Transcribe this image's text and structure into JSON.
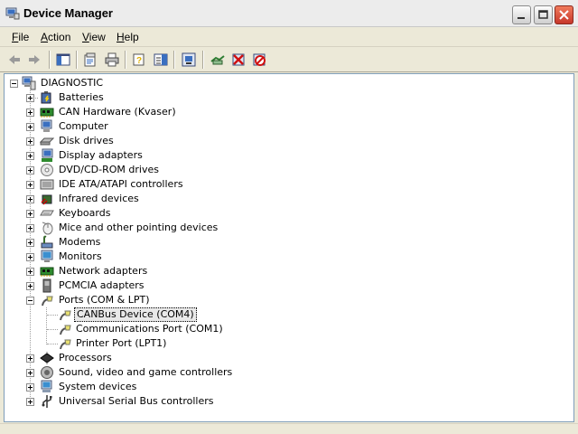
{
  "window": {
    "title": "Device Manager"
  },
  "menu": [
    {
      "label": "File",
      "accel": "F",
      "rest": "ile"
    },
    {
      "label": "Action",
      "accel": "A",
      "rest": "ction"
    },
    {
      "label": "View",
      "accel": "V",
      "rest": "iew"
    },
    {
      "label": "Help",
      "accel": "H",
      "rest": "elp"
    }
  ],
  "toolbar": {
    "buttons": [
      "back-icon",
      "forward-icon",
      "show-hide-tree-icon",
      "properties-icon",
      "print-icon",
      "help-icon",
      "export-list-icon",
      "update-driver-icon",
      "scan-hardware-icon",
      "uninstall-icon",
      "disable-icon"
    ]
  },
  "tree": {
    "root": "DIAGNOSTIC",
    "categories": [
      "Batteries",
      "CAN Hardware (Kvaser)",
      "Computer",
      "Disk drives",
      "Display adapters",
      "DVD/CD-ROM drives",
      "IDE ATA/ATAPI controllers",
      "Infrared devices",
      "Keyboards",
      "Mice and other pointing devices",
      "Modems",
      "Monitors",
      "Network adapters",
      "PCMCIA adapters",
      "Ports (COM & LPT)",
      "Processors",
      "Sound, video and game controllers",
      "System devices",
      "Universal Serial Bus controllers"
    ],
    "expanded_category": "Ports (COM & LPT)",
    "children": [
      "CANBus Device (COM4)",
      "Communications Port (COM1)",
      "Printer Port (LPT1)"
    ],
    "selected": "CANBus Device (COM4)"
  }
}
